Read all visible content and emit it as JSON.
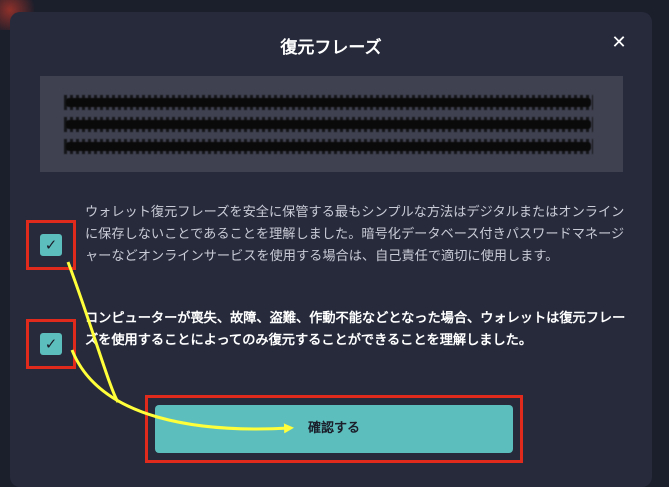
{
  "dialog": {
    "title": "復元フレーズ",
    "close_label": "✕"
  },
  "consents": [
    {
      "checked": true,
      "text": "ウォレット復元フレーズを安全に保管する最もシンプルな方法はデジタルまたはオンラインに保存しないことであることを理解しました。暗号化データベース付きパスワードマネージャーなどオンラインサービスを使用する場合は、自己責任で適切に使用します。"
    },
    {
      "checked": true,
      "text": "コンピューターが喪失、故障、盗難、作動不能などとなった場合、ウォレットは復元フレーズを使用することによってのみ復元することができることを理解しました。"
    }
  ],
  "confirm_button": {
    "label": "確認する"
  },
  "checkbox_glyph": "✓",
  "colors": {
    "accent": "#5dbfbd",
    "highlight": "#e02a1c",
    "arrow": "#ffff3a"
  }
}
